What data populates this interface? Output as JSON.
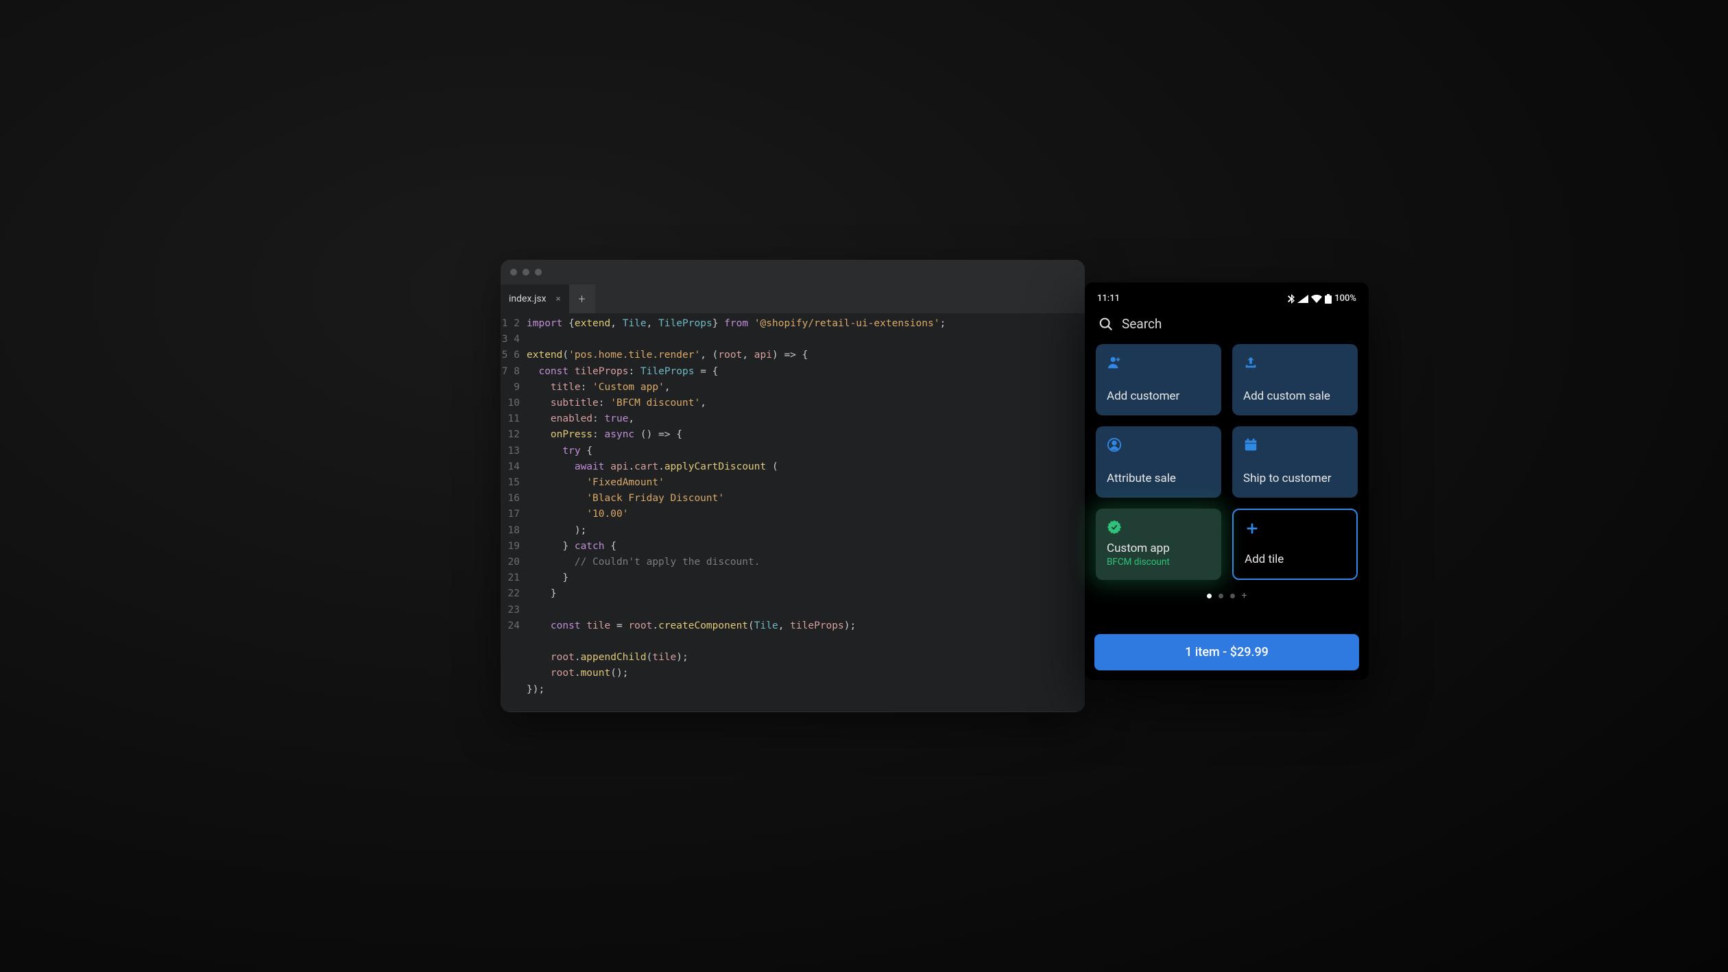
{
  "editor": {
    "tab_label": "index.jsx",
    "line_count": 24,
    "code_lines": [
      [
        [
          "kw",
          "import"
        ],
        [
          "pl",
          " {"
        ],
        [
          "fn",
          "extend"
        ],
        [
          "pl",
          ", "
        ],
        [
          "type",
          "Tile"
        ],
        [
          "pl",
          ", "
        ],
        [
          "type",
          "TileProps"
        ],
        [
          "pl",
          "} "
        ],
        [
          "kw",
          "from"
        ],
        [
          "pl",
          " "
        ],
        [
          "str",
          "'@shopify/retail-ui-extensions'"
        ],
        [
          "pl",
          ";"
        ]
      ],
      [],
      [
        [
          "fn",
          "extend"
        ],
        [
          "pl",
          "("
        ],
        [
          "str",
          "'pos.home.tile.render'"
        ],
        [
          "pl",
          ", ("
        ],
        [
          "var",
          "root"
        ],
        [
          "pl",
          ", "
        ],
        [
          "var",
          "api"
        ],
        [
          "pl",
          ") => {"
        ]
      ],
      [
        [
          "pl",
          "  "
        ],
        [
          "kw",
          "const"
        ],
        [
          "pl",
          " "
        ],
        [
          "var",
          "tileProps"
        ],
        [
          "pl",
          ": "
        ],
        [
          "type",
          "TileProps"
        ],
        [
          "pl",
          " = {"
        ]
      ],
      [
        [
          "pl",
          "    "
        ],
        [
          "var",
          "title"
        ],
        [
          "pl",
          ": "
        ],
        [
          "str",
          "'Custom app'"
        ],
        [
          "pl",
          ","
        ]
      ],
      [
        [
          "pl",
          "    "
        ],
        [
          "var",
          "subtitle"
        ],
        [
          "pl",
          ": "
        ],
        [
          "str",
          "'BFCM discount'"
        ],
        [
          "pl",
          ","
        ]
      ],
      [
        [
          "pl",
          "    "
        ],
        [
          "var",
          "enabled"
        ],
        [
          "pl",
          ": "
        ],
        [
          "bool",
          "true"
        ],
        [
          "pl",
          ","
        ]
      ],
      [
        [
          "pl",
          "    "
        ],
        [
          "fn",
          "onPress"
        ],
        [
          "pl",
          ": "
        ],
        [
          "kw",
          "async"
        ],
        [
          "pl",
          " () => {"
        ]
      ],
      [
        [
          "pl",
          "      "
        ],
        [
          "kw",
          "try"
        ],
        [
          "pl",
          " {"
        ]
      ],
      [
        [
          "pl",
          "        "
        ],
        [
          "kw",
          "await"
        ],
        [
          "pl",
          " "
        ],
        [
          "var",
          "api"
        ],
        [
          "pl",
          "."
        ],
        [
          "var",
          "cart"
        ],
        [
          "pl",
          "."
        ],
        [
          "fn",
          "applyCartDiscount"
        ],
        [
          "pl",
          " ("
        ]
      ],
      [
        [
          "pl",
          "          "
        ],
        [
          "str",
          "'FixedAmount'"
        ]
      ],
      [
        [
          "pl",
          "          "
        ],
        [
          "str",
          "'Black Friday Discount'"
        ]
      ],
      [
        [
          "pl",
          "          "
        ],
        [
          "str",
          "'10.00'"
        ]
      ],
      [
        [
          "pl",
          "        );"
        ]
      ],
      [
        [
          "pl",
          "      } "
        ],
        [
          "kw",
          "catch"
        ],
        [
          "pl",
          " {"
        ]
      ],
      [
        [
          "pl",
          "        "
        ],
        [
          "cmt",
          "// Couldn't apply the discount."
        ]
      ],
      [
        [
          "pl",
          "      }"
        ]
      ],
      [
        [
          "pl",
          "    }"
        ]
      ],
      [],
      [
        [
          "pl",
          "    "
        ],
        [
          "kw",
          "const"
        ],
        [
          "pl",
          " "
        ],
        [
          "var",
          "tile"
        ],
        [
          "pl",
          " = "
        ],
        [
          "var",
          "root"
        ],
        [
          "pl",
          "."
        ],
        [
          "fn",
          "createComponent"
        ],
        [
          "pl",
          "("
        ],
        [
          "type",
          "Tile"
        ],
        [
          "pl",
          ", "
        ],
        [
          "var",
          "tileProps"
        ],
        [
          "pl",
          ");"
        ]
      ],
      [],
      [
        [
          "pl",
          "    "
        ],
        [
          "var",
          "root"
        ],
        [
          "pl",
          "."
        ],
        [
          "fn",
          "appendChild"
        ],
        [
          "pl",
          "("
        ],
        [
          "var",
          "tile"
        ],
        [
          "pl",
          ");"
        ]
      ],
      [
        [
          "pl",
          "    "
        ],
        [
          "var",
          "root"
        ],
        [
          "pl",
          "."
        ],
        [
          "fn",
          "mount"
        ],
        [
          "pl",
          "();"
        ]
      ],
      [
        [
          "pl",
          "});"
        ]
      ]
    ]
  },
  "phone": {
    "time": "11:11",
    "battery": "100%",
    "search_label": "Search",
    "tiles": {
      "add_customer": "Add customer",
      "add_custom_sale": "Add custom sale",
      "attribute_sale": "Attribute sale",
      "ship_to_customer": "Ship to customer",
      "custom_app_title": "Custom app",
      "custom_app_subtitle": "BFCM discount",
      "add_tile": "Add tile"
    },
    "cart_button": "1 item - $29.99"
  }
}
